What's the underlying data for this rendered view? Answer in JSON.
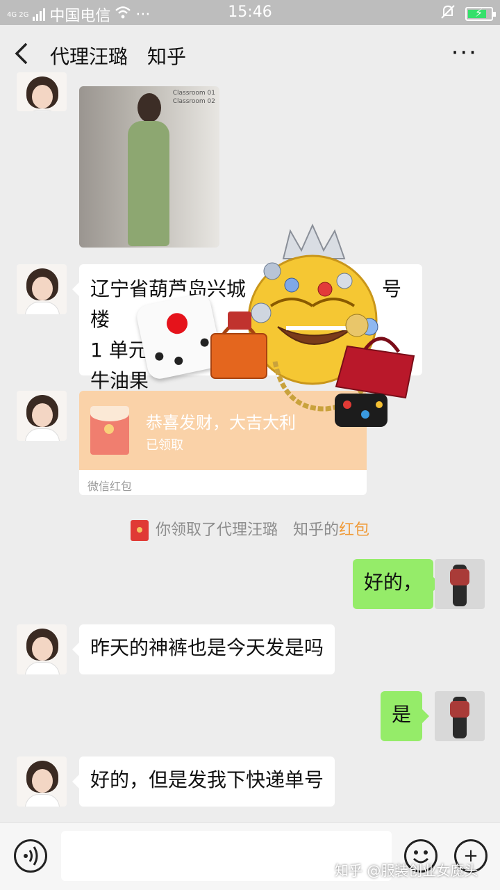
{
  "status_bar": {
    "network": "4G 2G",
    "carrier": "中国电信",
    "time": "15:46",
    "battery_level": 0.8,
    "dots": "···"
  },
  "header": {
    "title": "代理汪璐　知乎",
    "back_icon": "chevron-left-icon",
    "more_icon": "more-dots-icon",
    "more_label": "···"
  },
  "messages": {
    "address_line1": "辽宁省葫芦岛兴城　　　　　　　号楼",
    "address_line2": "1 单元",
    "address_line3": "牛油果",
    "red_packet_title": "恭喜发财，大吉大利",
    "red_packet_status": "已领取",
    "red_packet_footer": "微信红包",
    "sys_prefix": "你领取了代理汪璐　知乎的",
    "sys_highlight": "红包",
    "reply1": "好的，",
    "question": "昨天的神裤也是今天发是吗",
    "reply2": "是",
    "last": "好的，但是发我下快递单号"
  },
  "photo_sign": "Classroom 01\nClassroom 02",
  "input_bar": {
    "voice_icon": "voice-icon",
    "emoji_icon": "emoji-icon",
    "plus_icon": "plus-icon",
    "plus_label": "+"
  },
  "watermark": "知乎 @服装创业女魔头",
  "colors": {
    "green_bubble": "#95ec69",
    "red_packet": "#fad2a8",
    "highlight": "#f09a37"
  }
}
